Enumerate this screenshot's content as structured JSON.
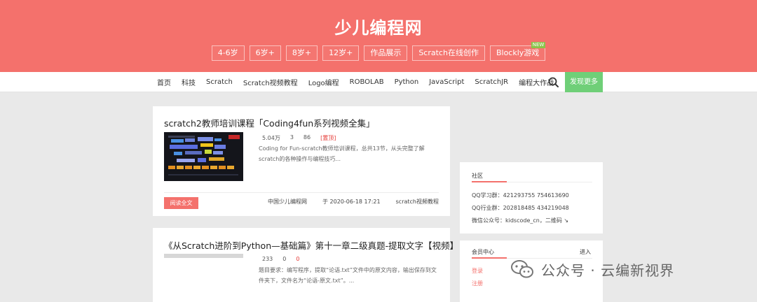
{
  "site": {
    "title": "少儿编程网"
  },
  "categories": [
    {
      "label": "4-6岁"
    },
    {
      "label": "6岁+"
    },
    {
      "label": "8岁+"
    },
    {
      "label": "12岁+"
    },
    {
      "label": "作品展示"
    },
    {
      "label": "Scratch在线创作"
    },
    {
      "label": "Blockly游戏",
      "badge": "NEW"
    }
  ],
  "nav": {
    "items": [
      "首页",
      "科技",
      "Scratch",
      "Scratch视频教程",
      "Logo编程",
      "ROBOLAB",
      "Python",
      "JavaScript",
      "ScratchJR",
      "编程大作战"
    ],
    "search_icon": "search-icon",
    "discover_label": "发现更多"
  },
  "posts": [
    {
      "title": "scratch2教师培训课程「Coding4fun系列视频全集」",
      "views": "5.04万",
      "comments": "3",
      "likes": "86",
      "tag": "[置顶]",
      "excerpt": "Coding for Fun-scratch教师培训课程，总共13节，从头完整了解scratch的各种操作与编程技巧...",
      "read_label": "阅读全文",
      "author": "中国少儿编程网",
      "date": "于 2020-06-18 17:21",
      "category": "scratch视频教程"
    },
    {
      "title": "《从Scratch进阶到Python—基础篇》第十一章二级真题-提取文字【视频】",
      "views": "233",
      "comments": "0",
      "likes": "0",
      "excerpt": "题目要求：编写程序，提取“论语.txt”文件中的原文内容，输出保存到文件夹下，文件名为“论语-原文.txt”。..."
    }
  ],
  "sidebar": {
    "community": {
      "title": "社区",
      "lines": [
        "QQ学习群：421293755 754613690",
        "QQ行业群：202818485 434219048",
        "微信公众号：kidscode_cn，二维码 ↘"
      ]
    },
    "member": {
      "title": "会员中心",
      "enter": "进入",
      "login": "登录",
      "register": "注册"
    }
  },
  "watermark": {
    "text": "公众号 · 云编新视界",
    "icon": "wechat-icon"
  },
  "colors": {
    "brand": "#f4716c",
    "discover": "#6fcf78",
    "hot": "#e53935"
  }
}
